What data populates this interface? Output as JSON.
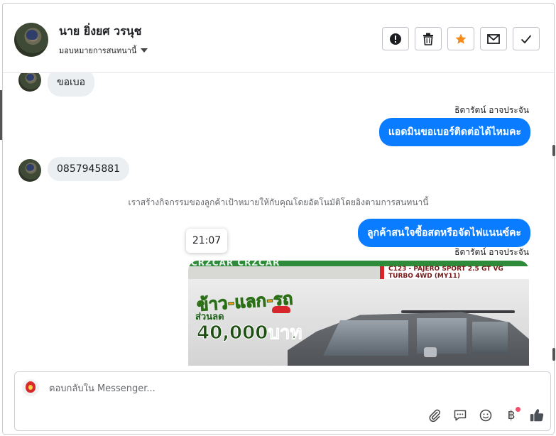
{
  "header": {
    "contact_name": "นาย ยิ่งยศ วรนุช",
    "assign_label": "มอบหมายการสนทนานี้",
    "actions": [
      {
        "name": "report",
        "icon": "exclamation-icon"
      },
      {
        "name": "delete",
        "icon": "trash-icon"
      },
      {
        "name": "star",
        "icon": "star-icon",
        "color": "#f28b1c"
      },
      {
        "name": "mark-unread",
        "icon": "envelope-icon"
      },
      {
        "name": "mark-done",
        "icon": "check-icon"
      }
    ]
  },
  "messages": {
    "m1_text": "ขอเบอ",
    "m2_sender": "ธิดารัตน์ อาจประจัน",
    "m2_text": "แอดมินขอเบอร์ติดต่อได้ไหมคะ",
    "m3_text": "0857945881",
    "system_note": "เราสร้างกิจกรรมของลูกค้าเป้าหมายให้กับคุณโดยอัตโนมัติโดยอิงตามการสนทนานี้",
    "m4_text": "ลูกค้าสนใจซื้อสดหรือจัดไฟแนนซ์คะ",
    "m4_sender": "ธิดารัตน์ อาจประจัน",
    "time_tooltip": "21:07"
  },
  "attachment": {
    "top_text": "CRZCAR CRZCAR",
    "model_label": "C123 - PAJERO SPORT 2.5 GT VG TURBO 4WD (MY11)",
    "promo_title": "ข้าว-แลก-รถ",
    "promo_discount_label": "ส่วนลด",
    "promo_amount": "40,000บาท"
  },
  "composer": {
    "placeholder": "ตอบกลับใน Messenger..."
  },
  "composer_tools": [
    "attachment-icon",
    "chat-bubble-icon",
    "emoji-icon",
    "baht-icon",
    "like-icon"
  ],
  "colors": {
    "outgoing_bubble": "#0a7cff",
    "incoming_bubble": "#eceff2",
    "star": "#f28b1c"
  },
  "baht_symbol": "฿"
}
